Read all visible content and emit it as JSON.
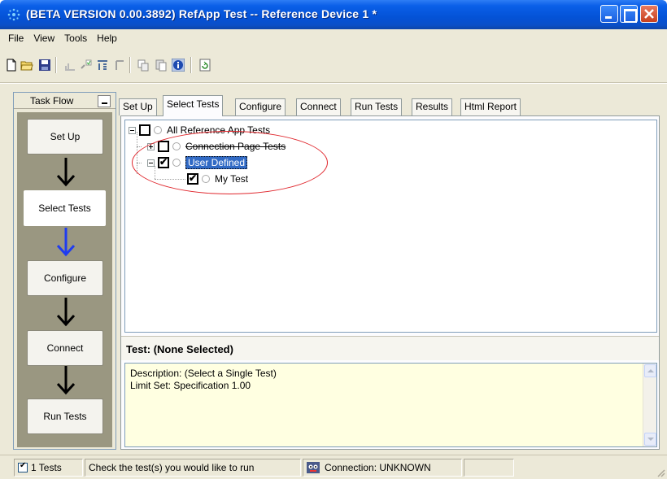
{
  "window": {
    "title": "(BETA VERSION 0.00.3892) RefApp Test -- Reference Device 1 *"
  },
  "menu": [
    "File",
    "View",
    "Tools",
    "Help"
  ],
  "toolbar_icons": [
    "new-file-icon",
    "open-folder-icon",
    "save-icon",
    "chart-icon",
    "test-check-icon",
    "test-list-icon",
    "marker-icon",
    "copy-icon",
    "paste-icon",
    "info-icon",
    "refresh-icon"
  ],
  "task_flow": {
    "title": "Task Flow",
    "steps": [
      "Set Up",
      "Select Tests",
      "Configure",
      "Connect",
      "Run Tests"
    ],
    "active_step": "Select Tests",
    "arrow_color_active": "#1f3cf0",
    "arrow_color": "#000000"
  },
  "tabs": [
    "Set Up",
    "Select Tests",
    "Configure",
    "Connect",
    "Run Tests",
    "Results",
    "Html Report"
  ],
  "active_tab": "Select Tests",
  "tree": {
    "root": "All Reference App Tests",
    "connection": "Connection Page Tests",
    "user_defined": "User Defined",
    "my_test": "My Test"
  },
  "highlight_color": "#e0262c",
  "detail": {
    "title": "Test: (None Selected)",
    "description": "Description: (Select a Single Test)",
    "limit_set": "Limit Set: Specification 1.00"
  },
  "status": {
    "tests_count": "1 Tests",
    "hint": "Check the test(s) you would like to run",
    "connection": "Connection: UNKNOWN"
  }
}
